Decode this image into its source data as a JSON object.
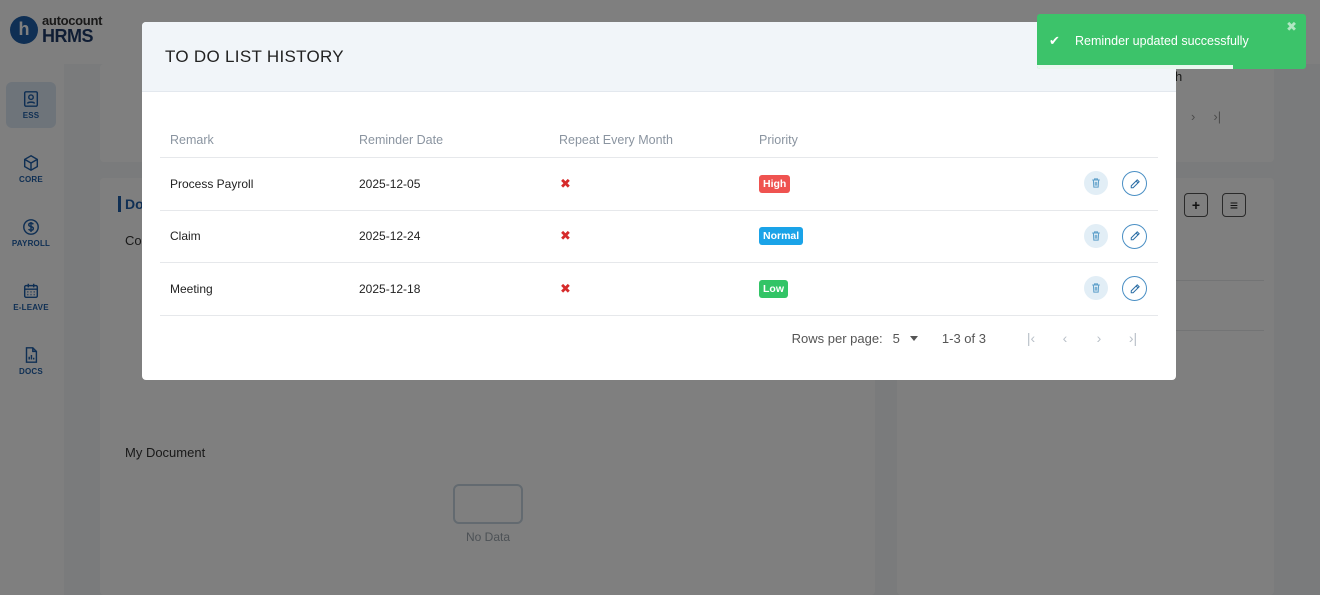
{
  "app": {
    "logo_small": "autocount",
    "logo_big": "HRMS",
    "logo_letter": "h"
  },
  "sidebar": {
    "items": [
      {
        "label": "ESS",
        "icon": "user-id-icon"
      },
      {
        "label": "CORE",
        "icon": "cube-icon"
      },
      {
        "label": "PAYROLL",
        "icon": "dollar-icon"
      },
      {
        "label": "E-LEAVE",
        "icon": "calendar-icon"
      },
      {
        "label": "DOCS",
        "icon": "document-chart-icon"
      }
    ]
  },
  "background": {
    "card_title_fragment": "Do",
    "label_fragment": "Co",
    "my_document": "My Document",
    "no_data": "No Data",
    "right_fragment": "h"
  },
  "modal": {
    "title": "TO DO LIST HISTORY",
    "columns": [
      "Remark",
      "Reminder Date",
      "Repeat Every Month",
      "Priority"
    ],
    "rows": [
      {
        "remark": "Process Payroll",
        "date": "2025-12-05",
        "repeat": "✖",
        "priority": "High",
        "priority_color": "#ef5350"
      },
      {
        "remark": "Claim",
        "date": "2025-12-24",
        "repeat": "✖",
        "priority": "Normal",
        "priority_color": "#1aa3e8"
      },
      {
        "remark": "Meeting",
        "date": "2025-12-18",
        "repeat": "✖",
        "priority": "Low",
        "priority_color": "#32c466"
      }
    ],
    "pagination": {
      "rows_per_page_label": "Rows per page:",
      "rows_per_page_value": "5",
      "range": "1-3 of 3"
    }
  },
  "toast": {
    "message": "Reminder updated successfully",
    "close": "✖",
    "check": "✔",
    "progress": 0.73,
    "color": "#3cc36a"
  }
}
